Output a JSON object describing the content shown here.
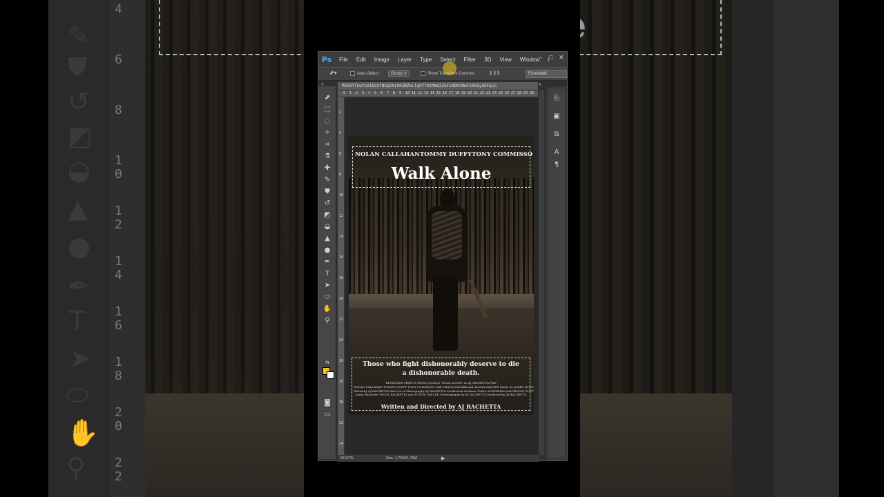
{
  "app": {
    "logo": "Ps",
    "menu": [
      "File",
      "Edit",
      "Image",
      "Layer",
      "Type",
      "Select",
      "Filter",
      "3D",
      "View",
      "Window",
      "l"
    ]
  },
  "options_bar": {
    "auto_select_label": "Auto-Select:",
    "auto_select_value": "Group",
    "transform_label": "Show Transform Controls",
    "workspace": "Essentials"
  },
  "document": {
    "tab_title": "MV5BYTAwYzA1NzUtNGQ2Ni00ZWZkLTg0YTAtMmQ2ZGFiNDRiMmFkXkEyXkFqcG",
    "zoom": "66.67%",
    "doc_info": "Doc: 1.76M/1.76M",
    "ruler_top": [
      "0",
      "1",
      "2",
      "3",
      "4",
      "5",
      "6",
      "7",
      "8",
      "9",
      "10",
      "11",
      "12",
      "13",
      "14",
      "15",
      "16",
      "17",
      "18",
      "19",
      "20",
      "21",
      "22",
      "23",
      "24",
      "25",
      "26",
      "27",
      "28",
      "29",
      "30"
    ],
    "ruler_left": [
      "2",
      "4",
      "6",
      "8",
      "10",
      "12",
      "14",
      "16",
      "18",
      "20",
      "22",
      "24",
      "26",
      "28",
      "30",
      "32",
      "34"
    ]
  },
  "poster": {
    "cast": [
      "NOLAN CALLAHAN",
      "TOMMY DUFFY",
      "TONY COMMISSO"
    ],
    "title": "Walk Alone",
    "tagline_line1": "Those who fight dishonorably deserve to die",
    "tagline_line2": "a dishonorable death.",
    "credits": [
      "RENEGADE PRODUCTIONS presents 'WALK ALONE' an AJ RACHETTA Film",
      "NOLAN CALLAHAN TOMMY DUFFY TONY COMMISSO with SHANE DOLABA and ALISSA SAWYER  Music by AVERY MUNGER",
      "Edited by AJ RACHETTA  Director of Photography AJ RACHETTA  Production Assistant DANA ACKERMAN and SKIDOO DUFFY",
      "Audio Recorder CHLOE RACHETTA and AUSTIN MILLER  Choreography by AJ RACHETTA  Produced by AJ RACHETTA"
    ],
    "directed_by": "Written and Directed by AJ RACHETTA"
  },
  "background": {
    "ruler_numbers": [
      "4",
      "6",
      "8",
      "1\n0",
      "1\n2",
      "1\n4",
      "1\n6",
      "1\n8",
      "2\n0",
      "2\n2"
    ],
    "glyph_text": "T",
    "letter_e": "e"
  },
  "colors": {
    "foreground": "#f0c51a",
    "background": "#ffffff",
    "ps_blue": "#3fa9f5"
  }
}
